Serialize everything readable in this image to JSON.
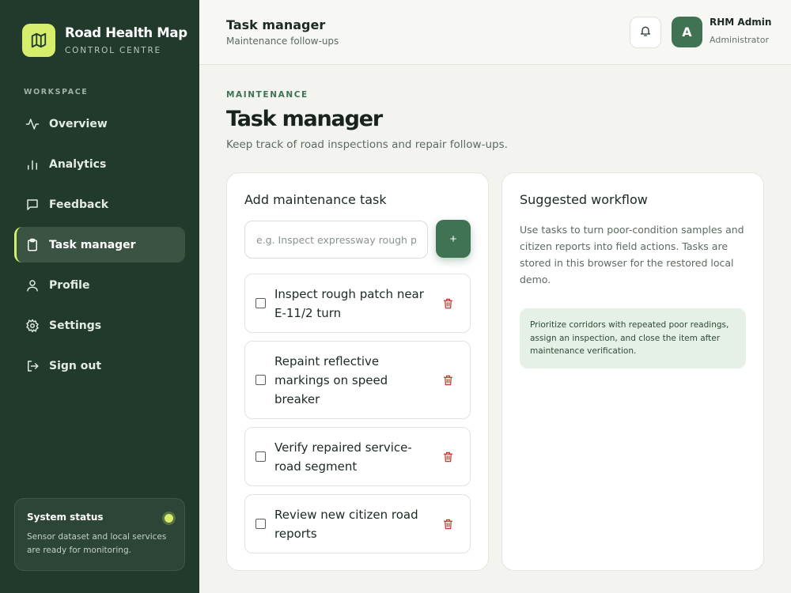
{
  "brand": {
    "title": "Road Health Map",
    "subtitle": "CONTROL CENTRE"
  },
  "sidebar": {
    "section_label": "WORKSPACE",
    "items": [
      {
        "label": "Overview",
        "icon": "activity-icon",
        "active": false
      },
      {
        "label": "Analytics",
        "icon": "bar-chart-icon",
        "active": false
      },
      {
        "label": "Feedback",
        "icon": "message-square-icon",
        "active": false
      },
      {
        "label": "Task manager",
        "icon": "clipboard-icon",
        "active": true
      },
      {
        "label": "Profile",
        "icon": "user-icon",
        "active": false
      },
      {
        "label": "Settings",
        "icon": "gear-icon",
        "active": false
      },
      {
        "label": "Sign out",
        "icon": "log-out-icon",
        "active": false
      }
    ],
    "status": {
      "title": "System status",
      "text": "Sensor dataset and local services are ready for monitoring."
    }
  },
  "header": {
    "title": "Task manager",
    "subtitle": "Maintenance follow-ups",
    "user": {
      "initial": "A",
      "name": "RHM Admin",
      "role": "Administrator"
    }
  },
  "main": {
    "eyebrow": "MAINTENANCE",
    "title": "Task manager",
    "description": "Keep track of road inspections and repair follow-ups."
  },
  "task_card": {
    "title": "Add maintenance task",
    "input_placeholder": "e.g. Inspect expressway rough patch",
    "input_value": "",
    "add_label": "+",
    "tasks": [
      {
        "text": "Inspect rough patch near E-11/2 turn",
        "done": false
      },
      {
        "text": "Repaint reflective markings on speed breaker",
        "done": false
      },
      {
        "text": "Verify repaired service-road segment",
        "done": false
      },
      {
        "text": "Review new citizen road reports",
        "done": false
      }
    ]
  },
  "workflow_card": {
    "title": "Suggested workflow",
    "text": "Use tasks to turn poor-condition samples and citizen reports into field actions. Tasks are stored in this browser for the restored local demo.",
    "note": "Prioritize corridors with repeated poor readings, assign an inspection, and close the item after maintenance verification."
  },
  "colors": {
    "sidebar_bg": "#223a2c",
    "accent": "#d5ee6c",
    "primary": "#3f7353",
    "danger": "#c0392b"
  }
}
